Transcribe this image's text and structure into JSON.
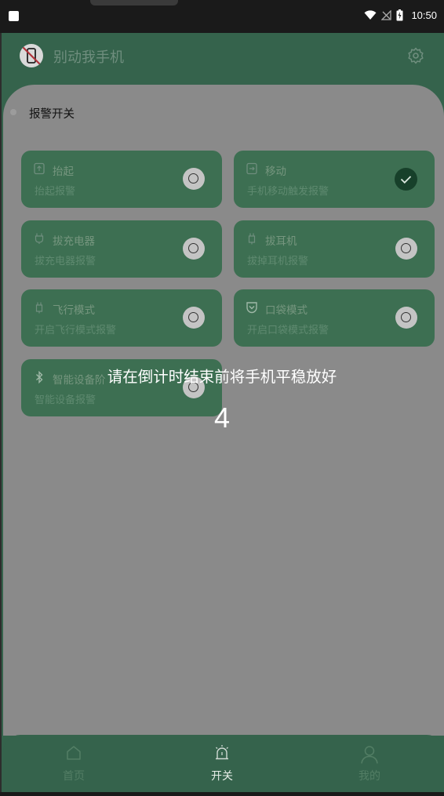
{
  "status_bar": {
    "time": "10:50"
  },
  "app": {
    "title": "别动我手机"
  },
  "section": {
    "label": "报警开关"
  },
  "cards": [
    {
      "title": "抬起",
      "subtitle": "抬起报警",
      "selected": false,
      "icon": "phone-lift-icon"
    },
    {
      "title": "移动",
      "subtitle": "手机移动触发报警",
      "selected": true,
      "icon": "phone-move-icon"
    },
    {
      "title": "拔充电器",
      "subtitle": "拔充电器报警",
      "selected": false,
      "icon": "plug-icon"
    },
    {
      "title": "拔耳机",
      "subtitle": "拔掉耳机报警",
      "selected": false,
      "icon": "earphone-plug-icon"
    },
    {
      "title": "飞行模式",
      "subtitle": "开启飞行模式报警",
      "selected": false,
      "icon": "plane-mode-icon"
    },
    {
      "title": "口袋模式",
      "subtitle": "开启口袋模式报警",
      "selected": false,
      "icon": "pocket-icon"
    },
    {
      "title": "智能设备阶",
      "subtitle": "智能设备报警",
      "selected": false,
      "icon": "bluetooth-icon"
    }
  ],
  "countdown": {
    "message": "请在倒计时结束前将手机平稳放好",
    "value": "4"
  },
  "nav": {
    "home": "首页",
    "switch": "开关",
    "mine": "我的"
  },
  "colors": {
    "header_bg": "#35634c",
    "card_bg": "#3d6f52",
    "overlay_gray": "#8a8a8a",
    "check_bg": "#17402a"
  }
}
